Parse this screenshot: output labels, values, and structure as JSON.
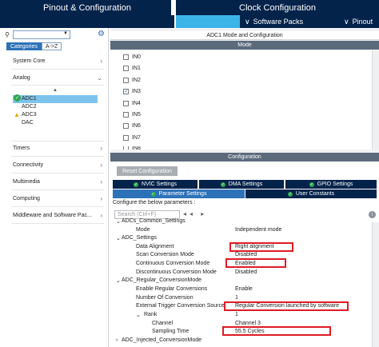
{
  "tabs": {
    "pinout": "Pinout & Configuration",
    "clock": "Clock Configuration",
    "software_packs": "Software Packs",
    "pinout_menu": "Pinout"
  },
  "sidebar": {
    "category_tabs": [
      "Categories",
      "A->Z"
    ],
    "categories": {
      "system_core": "System Core",
      "analog": "Analog",
      "timers": "Timers",
      "connectivity": "Connectivity",
      "multimedia": "Multimedia",
      "computing": "Computing",
      "middleware": "Middleware and Software Pac..."
    },
    "analog_items": [
      "ADC1",
      "ADC2",
      "ADC3",
      "DAC"
    ]
  },
  "mode_panel": {
    "title": "ADC1 Mode and Configuration",
    "mode_header": "Mode",
    "inputs": [
      {
        "label": "IN0",
        "checked": false
      },
      {
        "label": "IN1",
        "checked": false
      },
      {
        "label": "IN2",
        "checked": false
      },
      {
        "label": "IN3",
        "checked": true
      },
      {
        "label": "IN4",
        "checked": false
      },
      {
        "label": "IN5",
        "checked": false
      },
      {
        "label": "IN6",
        "checked": false
      },
      {
        "label": "IN7",
        "checked": false
      },
      {
        "label": "IN8",
        "checked": false
      }
    ]
  },
  "config_panel": {
    "header": "Configuration",
    "reset_button": "Reset Configuration",
    "tabs": {
      "nvic": "NVIC Settings",
      "dma": "DMA Settings",
      "gpio": "GPIO Settings",
      "param": "Parameter Settings",
      "user": "User Constants"
    },
    "configure_label": "Configure the below parameters :",
    "search_placeholder": "Search (Ctrl+F)",
    "params": {
      "common_settings": "ADCs_Common_Settings",
      "mode_label": "Mode",
      "mode_value": "Independent mode",
      "adc_settings": "ADC_Settings",
      "data_alignment_label": "Data Alignment",
      "data_alignment_value": "Right alignment",
      "scan_label": "Scan Conversion Mode",
      "scan_value": "Disabled",
      "continuous_label": "Continuous Conversion Mode",
      "continuous_value": "Enabled",
      "discontinuous_label": "Discontinuous Conversion Mode",
      "discontinuous_value": "Disabled",
      "regular_mode": "ADC_Regular_ConversionMode",
      "enable_regular_label": "Enable Regular Conversions",
      "enable_regular_value": "Enable",
      "num_conversion_label": "Number Of Conversion",
      "num_conversion_value": "1",
      "ext_trigger_label": "External Trigger Conversion Source",
      "ext_trigger_value": "Regular Conversion launched by software",
      "rank_label": "Rank",
      "rank_value": "1",
      "channel_label": "Channel",
      "channel_value": "Channel 3",
      "sampling_label": "Sampling Time",
      "sampling_value": "55.5 Cycles",
      "injected_mode": "ADC_Injected_ConversionMode"
    }
  },
  "colors": {
    "dark_navy": "#03234b",
    "accent_blue": "#2d72b8",
    "highlight": "#e01b24",
    "enabled_green": "#2fa84f"
  }
}
